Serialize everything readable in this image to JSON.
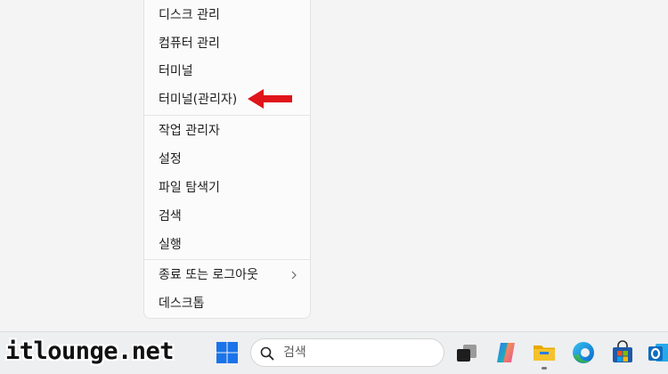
{
  "menu": {
    "items": [
      {
        "label": "디스크 관리"
      },
      {
        "label": "컴퓨터 관리"
      },
      {
        "label": "터미널"
      },
      {
        "label": "터미널(관리자)"
      },
      {
        "label": "작업 관리자"
      },
      {
        "label": "설정"
      },
      {
        "label": "파일 탐색기"
      },
      {
        "label": "검색"
      },
      {
        "label": "실행"
      },
      {
        "label": "종료 또는 로그아웃",
        "has_submenu": true
      },
      {
        "label": "데스크톱"
      }
    ],
    "submenu_icon": "chevron-right-icon"
  },
  "annotation": {
    "icon": "red-arrow-left-icon",
    "color": "#e0141b"
  },
  "watermark": {
    "text": "itlounge.net"
  },
  "taskbar": {
    "search": {
      "placeholder": "검색",
      "icon": "search-icon"
    },
    "apps": [
      {
        "name": "start-button",
        "icon": "windows-logo-icon",
        "color": "#1a73e8"
      },
      {
        "name": "task-view",
        "icon": "task-view-icon"
      },
      {
        "name": "copilot",
        "icon": "copilot-icon"
      },
      {
        "name": "file-explorer",
        "icon": "folder-icon",
        "color": "#f5b800",
        "running": true
      },
      {
        "name": "edge",
        "icon": "edge-icon"
      },
      {
        "name": "store",
        "icon": "store-icon"
      },
      {
        "name": "outlook",
        "icon": "outlook-icon",
        "color": "#0f6cbd"
      }
    ]
  }
}
